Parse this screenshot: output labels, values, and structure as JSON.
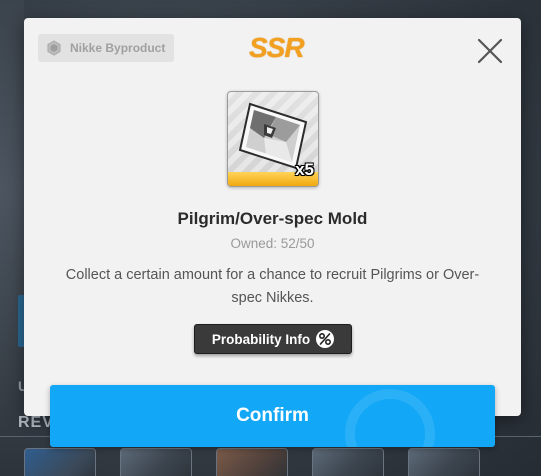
{
  "background": {
    "partial_letter": "U",
    "section_label": "REV"
  },
  "modal": {
    "category": {
      "label": "Nikke Byproduct",
      "icon": "hexagon-icon"
    },
    "rarity": "SSR",
    "item": {
      "name": "Pilgrim/Over-spec Mold",
      "quantity": "x5",
      "owned": "Owned: 52/50",
      "description": "Collect a certain amount for a chance to recruit Pilgrims or Over-spec Nikkes."
    },
    "probability_button": {
      "label": "Probability Info",
      "icon": "percent-icon"
    },
    "close_icon": "close-icon"
  },
  "confirm_button": {
    "label": "Confirm"
  },
  "colors": {
    "accent_blue": "#12a7f7",
    "rarity_orange": "#f2a020",
    "rarity_bar": "#f1a80e",
    "modal_bg": "#f2f2f2",
    "button_dark": "#3a3a3a"
  }
}
